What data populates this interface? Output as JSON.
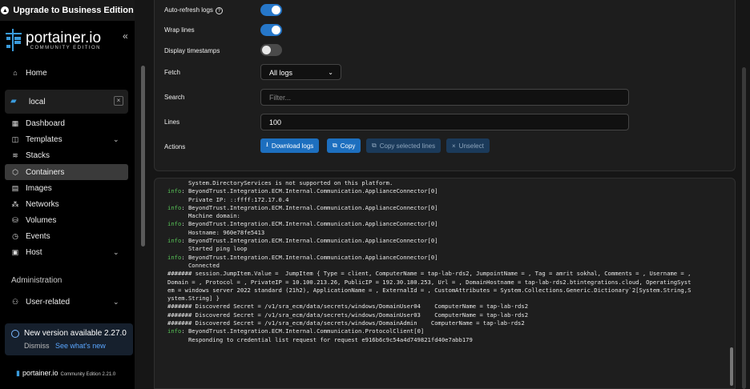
{
  "sidebar": {
    "upgrade_label": "Upgrade to Business Edition",
    "logo_name": "portainer.io",
    "logo_sub": "COMMUNITY EDITION",
    "collapse_icon": "«",
    "home": "Home",
    "environment": "local",
    "env_close": "×",
    "items": [
      {
        "label": "Dashboard",
        "icon": "dashboard-icon"
      },
      {
        "label": "Templates",
        "icon": "templates-icon"
      },
      {
        "label": "Stacks",
        "icon": "stacks-icon"
      },
      {
        "label": "Containers",
        "icon": "containers-icon"
      },
      {
        "label": "Images",
        "icon": "images-icon"
      },
      {
        "label": "Networks",
        "icon": "networks-icon"
      },
      {
        "label": "Volumes",
        "icon": "volumes-icon"
      },
      {
        "label": "Events",
        "icon": "events-icon"
      },
      {
        "label": "Host",
        "icon": "host-icon"
      }
    ],
    "admin_section": "Administration",
    "user_related": "User-related",
    "new_version": "New version available 2.27.0",
    "dismiss": "Dismiss",
    "see_whats_new": "See what's new",
    "footer_name": "portainer.io",
    "footer_edition": "Community Edition 2.21.0"
  },
  "settings": {
    "auto_refresh_label": "Auto-refresh logs",
    "auto_refresh_on": true,
    "wrap_lines_label": "Wrap lines",
    "wrap_lines_on": true,
    "timestamps_label": "Display timestamps",
    "timestamps_on": false,
    "fetch_label": "Fetch",
    "fetch_value": "All logs",
    "search_label": "Search",
    "search_placeholder": "Filter...",
    "lines_label": "Lines",
    "lines_value": "100",
    "actions_label": "Actions",
    "download_label": "Download logs",
    "copy_label": "Copy",
    "copy_selected_label": "Copy selected lines",
    "unselect_label": "Unselect"
  },
  "logs": [
    {
      "level": "",
      "text": "      System.DirectoryServices is not supported on this platform."
    },
    {
      "level": "info",
      "text": ": BeyondTrust.Integration.ECM.Internal.Communication.ApplianceConnector[0]"
    },
    {
      "level": "",
      "text": "      Private IP: ::ffff:172.17.0.4"
    },
    {
      "level": "info",
      "text": ": BeyondTrust.Integration.ECM.Internal.Communication.ApplianceConnector[0]"
    },
    {
      "level": "",
      "text": "      Machine domain:"
    },
    {
      "level": "info",
      "text": ": BeyondTrust.Integration.ECM.Internal.Communication.ApplianceConnector[0]"
    },
    {
      "level": "",
      "text": "      Hostname: 960e78fe5413"
    },
    {
      "level": "info",
      "text": ": BeyondTrust.Integration.ECM.Internal.Communication.ApplianceConnector[0]"
    },
    {
      "level": "",
      "text": "      Started ping loop"
    },
    {
      "level": "info",
      "text": ": BeyondTrust.Integration.ECM.Internal.Communication.ApplianceConnector[0]"
    },
    {
      "level": "",
      "text": "      Connected"
    },
    {
      "level": "",
      "text": "####### session.JumpItem.Value =  JumpItem { Type = client, ComputerName = tap-lab-rds2, JumpointName = , Tag = amrit sokhal, Comments = , Username = ,"
    },
    {
      "level": "",
      "text": "Domain = , Protocol = , PrivateIP = 10.100.213.26, PublicIP = 192.30.180.253, Url = , DomainHostname = tap-lab-rds2.btintegrations.cloud, OperatingSyst"
    },
    {
      "level": "",
      "text": "em = windows server 2022 standard (21h2), ApplicationName = , ExternalId = , CustomAttributes = System.Collections.Generic.Dictionary`2[System.String,S"
    },
    {
      "level": "",
      "text": "ystem.String] }"
    },
    {
      "level": "",
      "text": "####### Discovered Secret = /v1/sra_ecm/data/secrets/windows/DomainUser04    ComputerName = tap-lab-rds2"
    },
    {
      "level": "",
      "text": "####### Discovered Secret = /v1/sra_ecm/data/secrets/windows/DomainUser03    ComputerName = tap-lab-rds2"
    },
    {
      "level": "",
      "text": "####### Discovered Secret = /v1/sra_ecm/data/secrets/windows/DomainAdmin    ComputerName = tap-lab-rds2"
    },
    {
      "level": "info",
      "text": ": BeyondTrust.Integration.ECM.Internal.Communication.ProtocolClient[0]"
    },
    {
      "level": "",
      "text": "      Responding to credential list request for request e916b6c9c54a4d749821fd40e7abb179"
    }
  ]
}
